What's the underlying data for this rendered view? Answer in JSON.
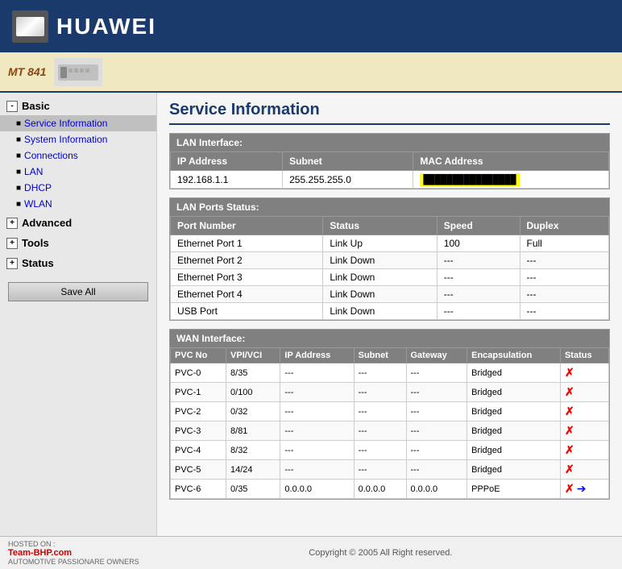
{
  "header": {
    "title": "HUAWEI",
    "model": "MT 841"
  },
  "page_title": "Service Information",
  "sidebar": {
    "basic_label": "Basic",
    "advanced_label": "Advanced",
    "tools_label": "Tools",
    "status_label": "Status",
    "items": [
      {
        "label": "Service Information",
        "active": true
      },
      {
        "label": "System Information"
      },
      {
        "label": "Connections"
      },
      {
        "label": "LAN"
      },
      {
        "label": "DHCP"
      },
      {
        "label": "WLAN"
      }
    ],
    "save_btn": "Save All"
  },
  "lan_interface": {
    "section_title": "LAN Interface:",
    "col_ip": "IP Address",
    "col_subnet": "Subnet",
    "col_mac": "MAC Address",
    "ip": "192.168.1.1",
    "subnet": "255.255.255.0",
    "mac": "██████████████"
  },
  "lan_ports": {
    "section_title": "LAN Ports Status:",
    "col_port": "Port Number",
    "col_status": "Status",
    "col_speed": "Speed",
    "col_duplex": "Duplex",
    "rows": [
      {
        "port": "Ethernet Port 1",
        "status": "Link Up",
        "speed": "100",
        "duplex": "Full"
      },
      {
        "port": "Ethernet Port 2",
        "status": "Link Down",
        "speed": "---",
        "duplex": "---"
      },
      {
        "port": "Ethernet Port 3",
        "status": "Link Down",
        "speed": "---",
        "duplex": "---"
      },
      {
        "port": "Ethernet Port 4",
        "status": "Link Down",
        "speed": "---",
        "duplex": "---"
      },
      {
        "port": "USB Port",
        "status": "Link Down",
        "speed": "---",
        "duplex": "---"
      }
    ]
  },
  "wan_interface": {
    "section_title": "WAN Interface:",
    "col_pvc": "PVC No",
    "col_vpi": "VPI/VCI",
    "col_ip": "IP Address",
    "col_subnet": "Subnet",
    "col_gateway": "Gateway",
    "col_encap": "Encapsulation",
    "col_status": "Status",
    "rows": [
      {
        "pvc": "PVC-0",
        "vpi": "8/35",
        "ip": "---",
        "subnet": "---",
        "gateway": "---",
        "encap": "Bridged",
        "status": "x"
      },
      {
        "pvc": "PVC-1",
        "vpi": "0/100",
        "ip": "---",
        "subnet": "---",
        "gateway": "---",
        "encap": "Bridged",
        "status": "x"
      },
      {
        "pvc": "PVC-2",
        "vpi": "0/32",
        "ip": "---",
        "subnet": "---",
        "gateway": "---",
        "encap": "Bridged",
        "status": "x"
      },
      {
        "pvc": "PVC-3",
        "vpi": "8/81",
        "ip": "---",
        "subnet": "---",
        "gateway": "---",
        "encap": "Bridged",
        "status": "x"
      },
      {
        "pvc": "PVC-4",
        "vpi": "8/32",
        "ip": "---",
        "subnet": "---",
        "gateway": "---",
        "encap": "Bridged",
        "status": "x"
      },
      {
        "pvc": "PVC-5",
        "vpi": "14/24",
        "ip": "---",
        "subnet": "---",
        "gateway": "---",
        "encap": "Bridged",
        "status": "x"
      },
      {
        "pvc": "PVC-6",
        "vpi": "0/35",
        "ip": "0.0.0.0",
        "subnet": "0.0.0.0",
        "gateway": "0.0.0.0",
        "encap": "PPPoE",
        "status": "x_link"
      }
    ]
  },
  "footer": {
    "copyright": "Copyright © 2005 All Right reserved.",
    "hosted_label": "HOSTED ON :",
    "bhp_label": "Team-BHP.com",
    "bhp_sub": "AUTOMOTIVE PASSIONARE OWNERS"
  }
}
